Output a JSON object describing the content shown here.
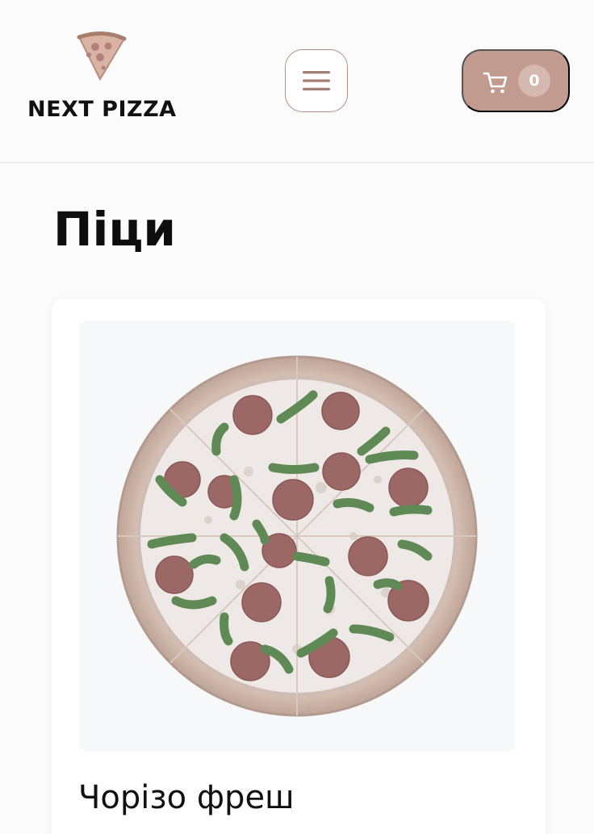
{
  "header": {
    "logo_text": "NEXT PIZZA",
    "menu_icon": "hamburger-menu-icon",
    "cart": {
      "icon": "cart-icon",
      "count": "0"
    }
  },
  "page": {
    "title": "Піци"
  },
  "products": [
    {
      "name": "Чорізо фреш",
      "image": "pizza-image"
    }
  ],
  "colors": {
    "accent": "#c29b90",
    "accent_light": "#d5b8b0",
    "border_accent": "#b28e84",
    "background": "#fbfbfc"
  }
}
